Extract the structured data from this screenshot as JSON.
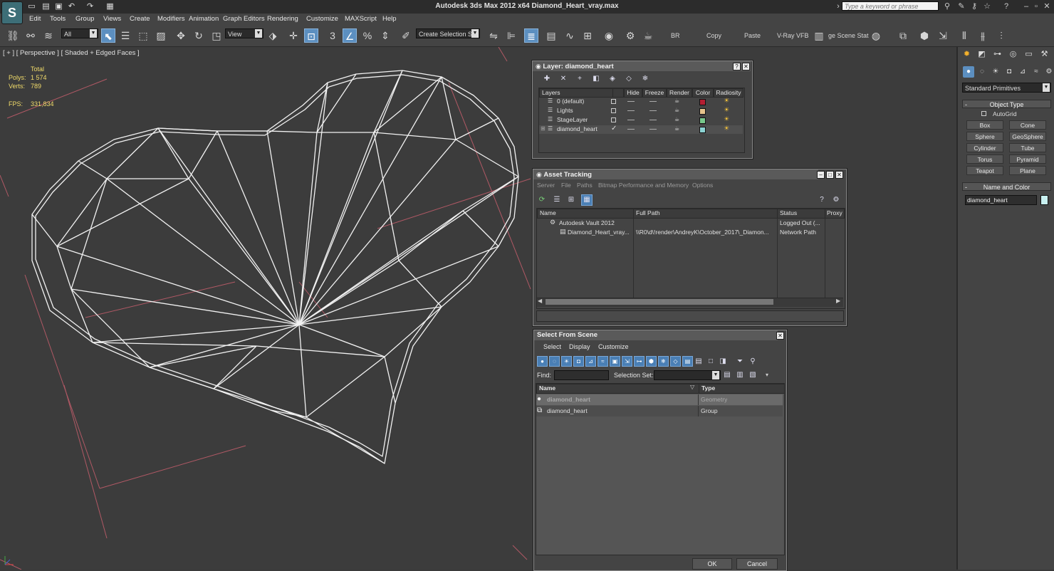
{
  "window": {
    "title": "Autodesk 3ds Max  2012 x64      Diamond_Heart_vray.max",
    "logo_letter": "S",
    "search_placeholder": "Type a keyword or phrase"
  },
  "menu": [
    "Edit",
    "Tools",
    "Group",
    "Views",
    "Create",
    "Modifiers",
    "Animation",
    "Graph Editors",
    "Rendering",
    "Customize",
    "MAXScript",
    "Help"
  ],
  "toolbar": {
    "filter_value": "All",
    "ref_coord_value": "View",
    "snap_label": "3",
    "selection_set_placeholder": "Create Selection Se",
    "text_buttons": [
      "BR",
      "Copy",
      "Paste",
      "V-Ray VFB",
      "ge Scene Stat"
    ]
  },
  "viewport": {
    "label": "[ + ] [ Perspective ] [ Shaded + Edged Faces ]",
    "stats_header": "Total",
    "polys_label": "Polys:",
    "polys_value": "1 574",
    "verts_label": "Verts:",
    "verts_value": "789",
    "fps_label": "FPS:",
    "fps_value": "331,834"
  },
  "layer_dialog": {
    "title": "Layer: diamond_heart",
    "columns": [
      "Layers",
      "Hide",
      "Freeze",
      "Render",
      "Color",
      "Radiosity"
    ],
    "rows": [
      {
        "name": "0 (default)",
        "checked": false,
        "color": "#b41e32"
      },
      {
        "name": "Lights",
        "checked": false,
        "color": "#e6c38c"
      },
      {
        "name": "StageLayer",
        "checked": false,
        "color": "#78c88c"
      },
      {
        "name": "diamond_heart",
        "checked": true,
        "color": "#8cd2d2"
      }
    ]
  },
  "asset_tracking": {
    "title": "Asset Tracking",
    "menu": [
      "Server",
      "File",
      "Paths",
      "Bitmap Performance and Memory",
      "Options"
    ],
    "columns": [
      "Name",
      "Full Path",
      "Status",
      "Proxy"
    ],
    "rows": [
      {
        "name": "Autodesk Vault 2012",
        "path": "",
        "status": "Logged Out (..."
      },
      {
        "name": "Diamond_Heart_vray...",
        "path": "\\\\R0\\d\\!render\\AndreyK\\October_2017\\_Diamon...",
        "status": "Network Path"
      }
    ]
  },
  "select_from_scene": {
    "title": "Select From Scene",
    "menu": [
      "Select",
      "Display",
      "Customize"
    ],
    "find_label": "Find:",
    "selection_set_label": "Selection Set:",
    "columns": [
      "Name",
      "Type"
    ],
    "rows": [
      {
        "name": "diamond_heart",
        "type": "Geometry",
        "selected": true
      },
      {
        "name": "diamond_heart",
        "type": "Group",
        "selected": false
      }
    ],
    "ok_label": "OK",
    "cancel_label": "Cancel"
  },
  "command_panel": {
    "category_value": "Standard Primitives",
    "object_type_header": "Object Type",
    "autogrid_label": "AutoGrid",
    "primitives": [
      "Box",
      "Cone",
      "Sphere",
      "GeoSphere",
      "Cylinder",
      "Tube",
      "Torus",
      "Pyramid",
      "Teapot",
      "Plane"
    ],
    "name_color_header": "Name and Color",
    "object_name": "diamond_heart",
    "object_color": "#c8f0f0"
  }
}
